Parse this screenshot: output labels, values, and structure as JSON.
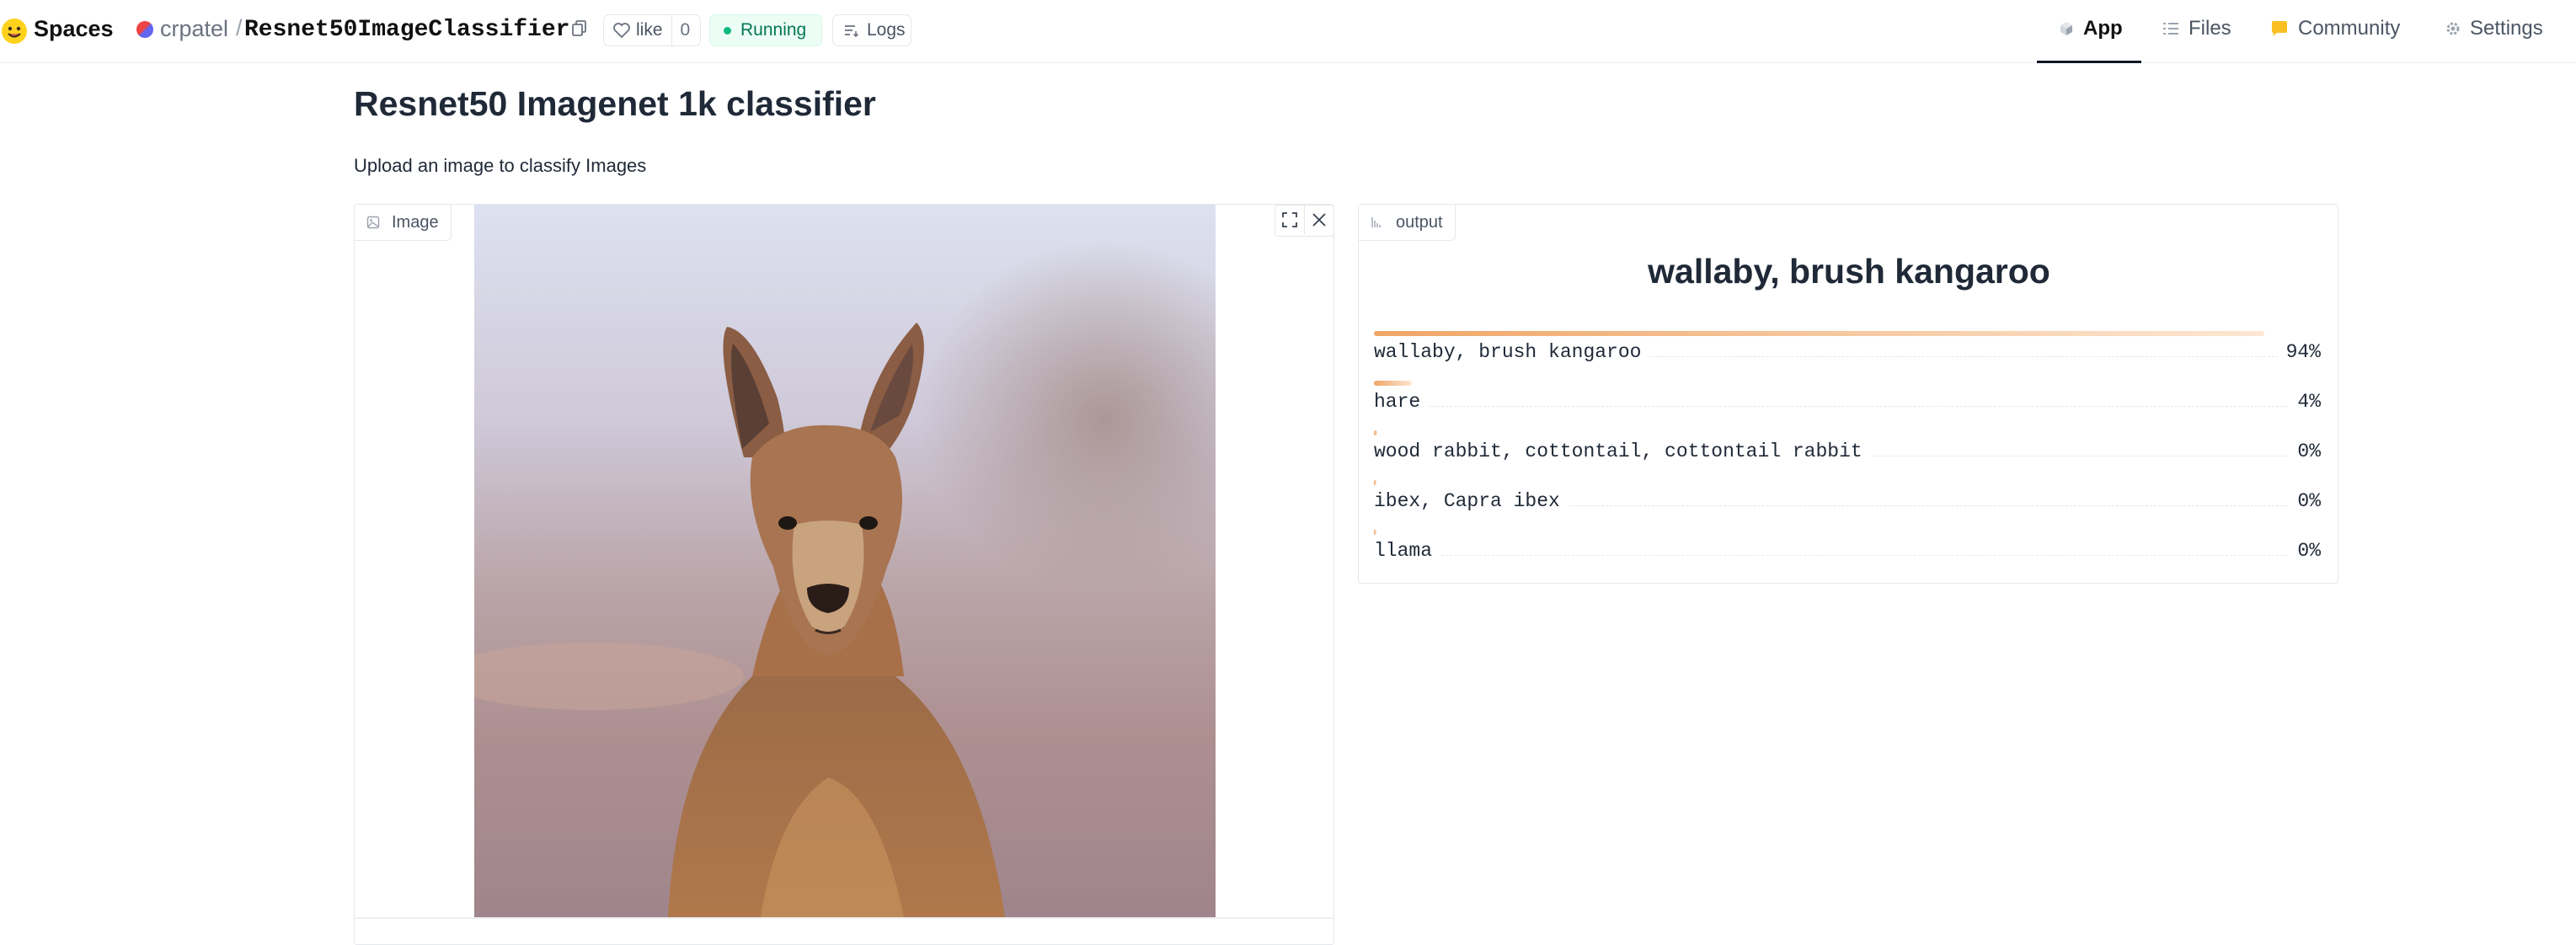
{
  "nav": {
    "brand": "Spaces",
    "owner": "crpatel",
    "separator": "/",
    "repo": "Resnet50ImageClassifier",
    "like_label": "like",
    "like_count": "0",
    "status": "Running",
    "logs_label": "Logs",
    "tabs": [
      {
        "label": "App",
        "icon": "cube-icon",
        "active": true
      },
      {
        "label": "Files",
        "icon": "files-icon"
      },
      {
        "label": "Community",
        "icon": "community-icon"
      },
      {
        "label": "Settings",
        "icon": "gear-icon"
      }
    ]
  },
  "page": {
    "title": "Resnet50 Imagenet 1k classifier",
    "description": "Upload an image to classify Images"
  },
  "input_panel": {
    "label": "Image",
    "image_alt": "kangaroo photo"
  },
  "output_panel": {
    "label": "output",
    "top_label": "wallaby, brush kangaroo",
    "confidences": [
      {
        "label": "wallaby, brush kangaroo",
        "pct": "94%",
        "value": 0.94
      },
      {
        "label": "hare",
        "pct": "4%",
        "value": 0.04
      },
      {
        "label": "wood rabbit, cottontail, cottontail rabbit",
        "pct": "0%",
        "value": 0.004
      },
      {
        "label": "ibex, Capra ibex",
        "pct": "0%",
        "value": 0.002
      },
      {
        "label": "llama",
        "pct": "0%",
        "value": 0.002
      }
    ]
  },
  "colors": {
    "accent": "#f0a566",
    "running_bg": "#ecfdf5",
    "running_text": "#047857"
  }
}
